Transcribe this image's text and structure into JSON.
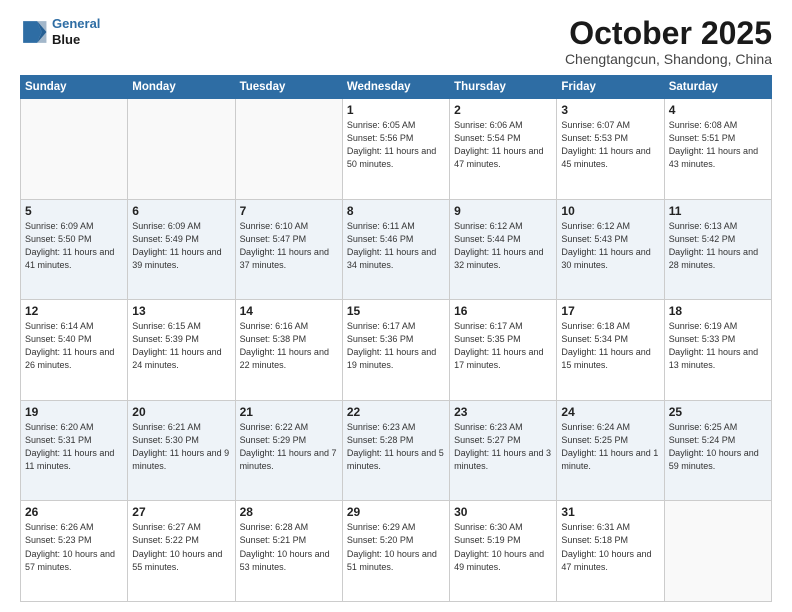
{
  "header": {
    "logo_line1": "General",
    "logo_line2": "Blue",
    "title": "October 2025",
    "subtitle": "Chengtangcun, Shandong, China"
  },
  "weekdays": [
    "Sunday",
    "Monday",
    "Tuesday",
    "Wednesday",
    "Thursday",
    "Friday",
    "Saturday"
  ],
  "weeks": [
    [
      {
        "day": "",
        "sunrise": "",
        "sunset": "",
        "daylight": ""
      },
      {
        "day": "",
        "sunrise": "",
        "sunset": "",
        "daylight": ""
      },
      {
        "day": "",
        "sunrise": "",
        "sunset": "",
        "daylight": ""
      },
      {
        "day": "1",
        "sunrise": "Sunrise: 6:05 AM",
        "sunset": "Sunset: 5:56 PM",
        "daylight": "Daylight: 11 hours and 50 minutes."
      },
      {
        "day": "2",
        "sunrise": "Sunrise: 6:06 AM",
        "sunset": "Sunset: 5:54 PM",
        "daylight": "Daylight: 11 hours and 47 minutes."
      },
      {
        "day": "3",
        "sunrise": "Sunrise: 6:07 AM",
        "sunset": "Sunset: 5:53 PM",
        "daylight": "Daylight: 11 hours and 45 minutes."
      },
      {
        "day": "4",
        "sunrise": "Sunrise: 6:08 AM",
        "sunset": "Sunset: 5:51 PM",
        "daylight": "Daylight: 11 hours and 43 minutes."
      }
    ],
    [
      {
        "day": "5",
        "sunrise": "Sunrise: 6:09 AM",
        "sunset": "Sunset: 5:50 PM",
        "daylight": "Daylight: 11 hours and 41 minutes."
      },
      {
        "day": "6",
        "sunrise": "Sunrise: 6:09 AM",
        "sunset": "Sunset: 5:49 PM",
        "daylight": "Daylight: 11 hours and 39 minutes."
      },
      {
        "day": "7",
        "sunrise": "Sunrise: 6:10 AM",
        "sunset": "Sunset: 5:47 PM",
        "daylight": "Daylight: 11 hours and 37 minutes."
      },
      {
        "day": "8",
        "sunrise": "Sunrise: 6:11 AM",
        "sunset": "Sunset: 5:46 PM",
        "daylight": "Daylight: 11 hours and 34 minutes."
      },
      {
        "day": "9",
        "sunrise": "Sunrise: 6:12 AM",
        "sunset": "Sunset: 5:44 PM",
        "daylight": "Daylight: 11 hours and 32 minutes."
      },
      {
        "day": "10",
        "sunrise": "Sunrise: 6:12 AM",
        "sunset": "Sunset: 5:43 PM",
        "daylight": "Daylight: 11 hours and 30 minutes."
      },
      {
        "day": "11",
        "sunrise": "Sunrise: 6:13 AM",
        "sunset": "Sunset: 5:42 PM",
        "daylight": "Daylight: 11 hours and 28 minutes."
      }
    ],
    [
      {
        "day": "12",
        "sunrise": "Sunrise: 6:14 AM",
        "sunset": "Sunset: 5:40 PM",
        "daylight": "Daylight: 11 hours and 26 minutes."
      },
      {
        "day": "13",
        "sunrise": "Sunrise: 6:15 AM",
        "sunset": "Sunset: 5:39 PM",
        "daylight": "Daylight: 11 hours and 24 minutes."
      },
      {
        "day": "14",
        "sunrise": "Sunrise: 6:16 AM",
        "sunset": "Sunset: 5:38 PM",
        "daylight": "Daylight: 11 hours and 22 minutes."
      },
      {
        "day": "15",
        "sunrise": "Sunrise: 6:17 AM",
        "sunset": "Sunset: 5:36 PM",
        "daylight": "Daylight: 11 hours and 19 minutes."
      },
      {
        "day": "16",
        "sunrise": "Sunrise: 6:17 AM",
        "sunset": "Sunset: 5:35 PM",
        "daylight": "Daylight: 11 hours and 17 minutes."
      },
      {
        "day": "17",
        "sunrise": "Sunrise: 6:18 AM",
        "sunset": "Sunset: 5:34 PM",
        "daylight": "Daylight: 11 hours and 15 minutes."
      },
      {
        "day": "18",
        "sunrise": "Sunrise: 6:19 AM",
        "sunset": "Sunset: 5:33 PM",
        "daylight": "Daylight: 11 hours and 13 minutes."
      }
    ],
    [
      {
        "day": "19",
        "sunrise": "Sunrise: 6:20 AM",
        "sunset": "Sunset: 5:31 PM",
        "daylight": "Daylight: 11 hours and 11 minutes."
      },
      {
        "day": "20",
        "sunrise": "Sunrise: 6:21 AM",
        "sunset": "Sunset: 5:30 PM",
        "daylight": "Daylight: 11 hours and 9 minutes."
      },
      {
        "day": "21",
        "sunrise": "Sunrise: 6:22 AM",
        "sunset": "Sunset: 5:29 PM",
        "daylight": "Daylight: 11 hours and 7 minutes."
      },
      {
        "day": "22",
        "sunrise": "Sunrise: 6:23 AM",
        "sunset": "Sunset: 5:28 PM",
        "daylight": "Daylight: 11 hours and 5 minutes."
      },
      {
        "day": "23",
        "sunrise": "Sunrise: 6:23 AM",
        "sunset": "Sunset: 5:27 PM",
        "daylight": "Daylight: 11 hours and 3 minutes."
      },
      {
        "day": "24",
        "sunrise": "Sunrise: 6:24 AM",
        "sunset": "Sunset: 5:25 PM",
        "daylight": "Daylight: 11 hours and 1 minute."
      },
      {
        "day": "25",
        "sunrise": "Sunrise: 6:25 AM",
        "sunset": "Sunset: 5:24 PM",
        "daylight": "Daylight: 10 hours and 59 minutes."
      }
    ],
    [
      {
        "day": "26",
        "sunrise": "Sunrise: 6:26 AM",
        "sunset": "Sunset: 5:23 PM",
        "daylight": "Daylight: 10 hours and 57 minutes."
      },
      {
        "day": "27",
        "sunrise": "Sunrise: 6:27 AM",
        "sunset": "Sunset: 5:22 PM",
        "daylight": "Daylight: 10 hours and 55 minutes."
      },
      {
        "day": "28",
        "sunrise": "Sunrise: 6:28 AM",
        "sunset": "Sunset: 5:21 PM",
        "daylight": "Daylight: 10 hours and 53 minutes."
      },
      {
        "day": "29",
        "sunrise": "Sunrise: 6:29 AM",
        "sunset": "Sunset: 5:20 PM",
        "daylight": "Daylight: 10 hours and 51 minutes."
      },
      {
        "day": "30",
        "sunrise": "Sunrise: 6:30 AM",
        "sunset": "Sunset: 5:19 PM",
        "daylight": "Daylight: 10 hours and 49 minutes."
      },
      {
        "day": "31",
        "sunrise": "Sunrise: 6:31 AM",
        "sunset": "Sunset: 5:18 PM",
        "daylight": "Daylight: 10 hours and 47 minutes."
      },
      {
        "day": "",
        "sunrise": "",
        "sunset": "",
        "daylight": ""
      }
    ]
  ]
}
